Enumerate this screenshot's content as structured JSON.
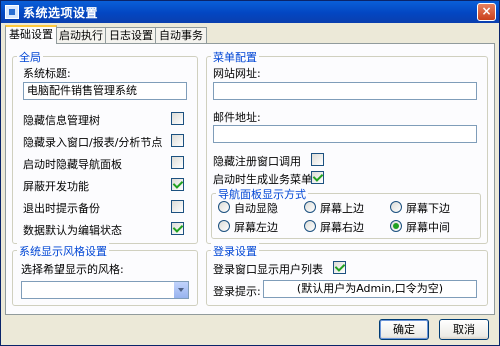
{
  "window": {
    "title": "系统选项设置",
    "close_symbol": "×"
  },
  "tabs": [
    {
      "label": "基础设置",
      "active": true
    },
    {
      "label": "启动执行"
    },
    {
      "label": "日志设置"
    },
    {
      "label": "自动事务"
    }
  ],
  "general": {
    "legend": "全局",
    "system_title_label": "系统标题:",
    "system_title_value": "电脑配件销售管理系统",
    "options": [
      {
        "label": "隐藏信息管理树",
        "checked": false
      },
      {
        "label": "隐藏录入窗口/报表/分析节点",
        "checked": false
      },
      {
        "label": "启动时隐藏导航面板",
        "checked": false
      },
      {
        "label": "屏蔽开发功能",
        "checked": true
      },
      {
        "label": "退出时提示备份",
        "checked": false
      },
      {
        "label": "数据默认为编辑状态",
        "checked": true
      }
    ]
  },
  "menu_config": {
    "legend": "菜单配置",
    "website_label": "网站网址:",
    "website_value": "",
    "email_label": "邮件地址:",
    "email_value": "",
    "hide_register_label": "隐藏注册窗口调用",
    "hide_register_checked": false,
    "gen_menu_label": "启动时生成业务菜单",
    "gen_menu_checked": true,
    "nav_legend": "导航面板显示方式",
    "nav_options": [
      {
        "label": "自动显隐",
        "selected": false
      },
      {
        "label": "屏幕上边",
        "selected": false
      },
      {
        "label": "屏幕下边",
        "selected": false
      },
      {
        "label": "屏幕左边",
        "selected": false
      },
      {
        "label": "屏幕右边",
        "selected": false
      },
      {
        "label": "屏幕中间",
        "selected": true
      }
    ]
  },
  "style_settings": {
    "legend": "系统显示风格设置",
    "select_label": "选择希望显示的风格:",
    "select_value": ""
  },
  "login_settings": {
    "legend": "登录设置",
    "show_users_label": "登录窗口显示用户列表",
    "show_users_checked": true,
    "prompt_label": "登录提示:",
    "prompt_value": "(默认用户为Admin,口令为空)"
  },
  "buttons": {
    "ok": "确定",
    "cancel": "取消"
  },
  "colors": {
    "title_bar": "#0346c2",
    "group_legend": "#0046d5",
    "check_mark": "#21a121",
    "tab_highlight": "#ffc83c"
  }
}
